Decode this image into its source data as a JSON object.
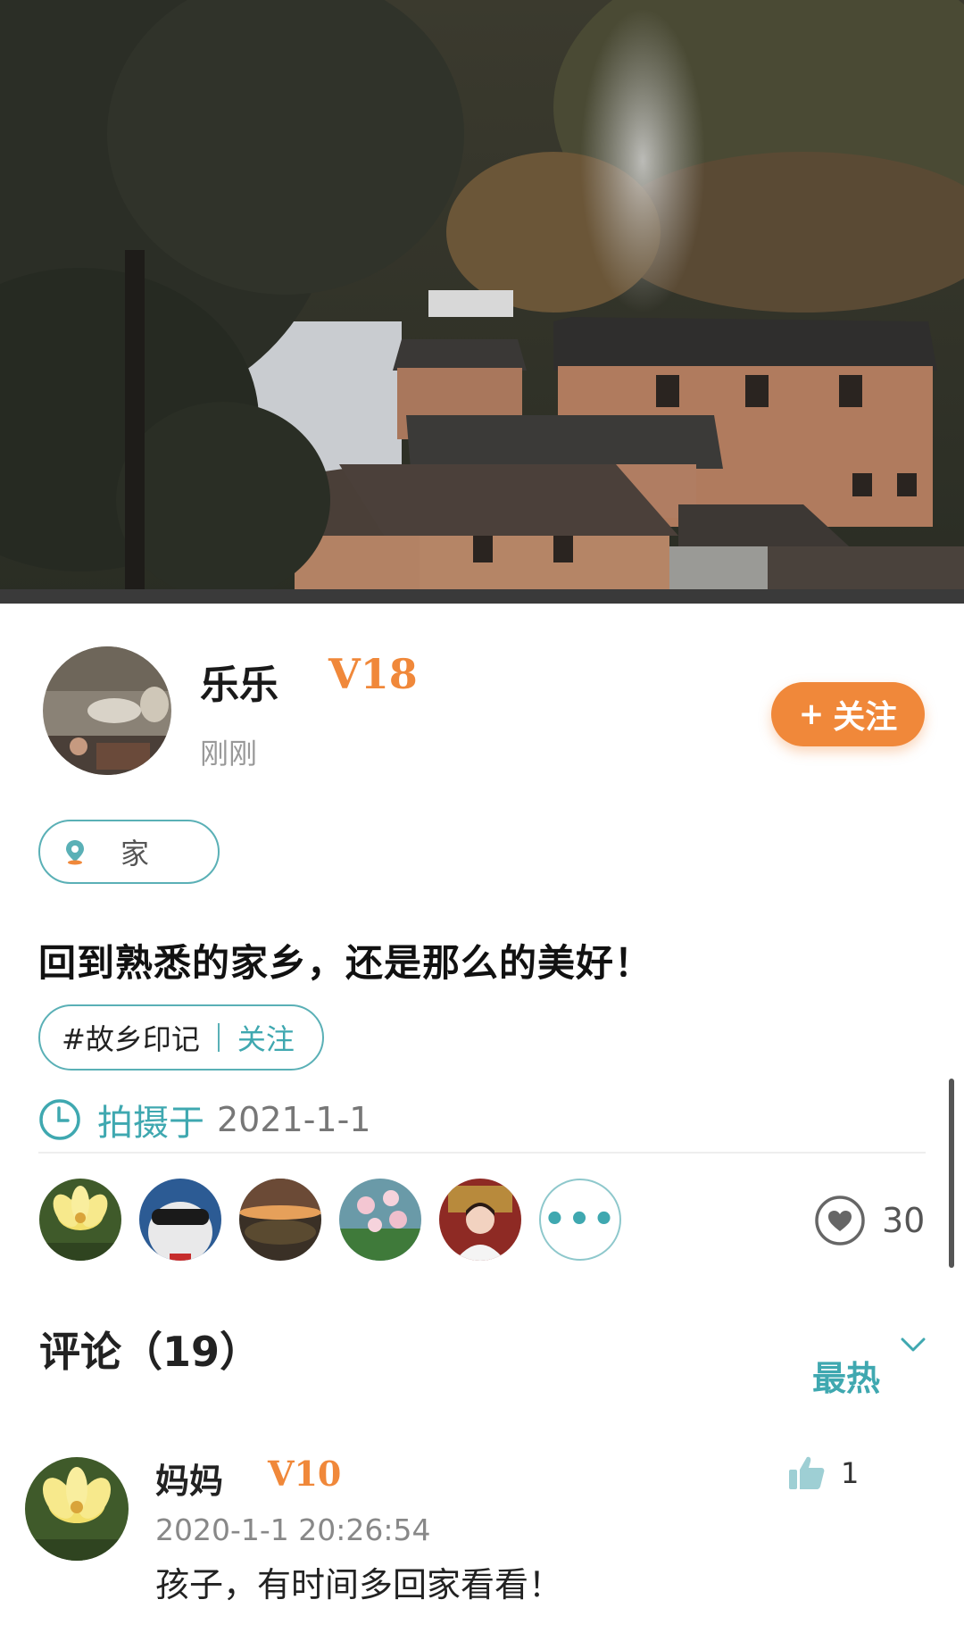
{
  "post": {
    "author": {
      "name": "乐乐",
      "level": "V18",
      "time": "刚刚"
    },
    "follow_button": {
      "plus": "+",
      "label": "关注"
    },
    "location": "家",
    "text": "回到熟悉的家乡，还是那么的美好！",
    "topic": {
      "name": "#故乡印记",
      "follow_label": "关注"
    },
    "taken_at": {
      "label": "拍摄于",
      "date": "2021-1-1"
    },
    "more_dots": "•••",
    "likes": {
      "count": "30",
      "liker_count": 5
    }
  },
  "comments": {
    "title": "评论（19）",
    "sort_label": "最热",
    "items": [
      {
        "name": "妈妈",
        "level": "V10",
        "time": "2020-1-1  20:26:54",
        "text": "孩子，有时间多回家看看！",
        "likes": "1"
      }
    ]
  },
  "colors": {
    "accent_teal": "#3fa8b0",
    "accent_orange": "#f0883a",
    "border_teal": "#5ab0b6"
  },
  "icons": [
    "location-pin-icon",
    "clock-icon",
    "heart-icon",
    "thumbs-up-icon",
    "chevron-down-icon",
    "more-dots-icon"
  ]
}
